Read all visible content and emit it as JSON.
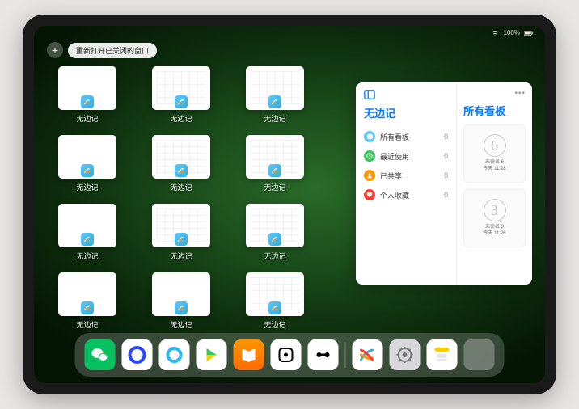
{
  "status": {
    "battery": "100%"
  },
  "topControls": {
    "add": "+",
    "reopenLabel": "重新打开已关闭的窗口"
  },
  "appWindows": [
    {
      "label": "无边记",
      "type": "blank"
    },
    {
      "label": "无边记",
      "type": "grid"
    },
    {
      "label": "无边记",
      "type": "grid"
    },
    {
      "label": "无边记",
      "type": "blank"
    },
    {
      "label": "无边记",
      "type": "grid"
    },
    {
      "label": "无边记",
      "type": "grid"
    },
    {
      "label": "无边记",
      "type": "blank"
    },
    {
      "label": "无边记",
      "type": "grid"
    },
    {
      "label": "无边记",
      "type": "grid"
    },
    {
      "label": "无边记",
      "type": "blank"
    },
    {
      "label": "无边记",
      "type": "blank"
    },
    {
      "label": "无边记",
      "type": "grid"
    }
  ],
  "sidePanel": {
    "leftTitle": "无边记",
    "rightTitle": "所有看板",
    "menu": [
      {
        "icon": "chat",
        "color": "#5ac8fa",
        "label": "所有看板",
        "count": "0"
      },
      {
        "icon": "clock",
        "color": "#34c759",
        "label": "最近使用",
        "count": "0"
      },
      {
        "icon": "person",
        "color": "#ff9500",
        "label": "已共享",
        "count": "0"
      },
      {
        "icon": "heart",
        "color": "#ff3b30",
        "label": "个人收藏",
        "count": "0"
      }
    ],
    "boards": [
      {
        "sketch": "6",
        "name": "未命名 6",
        "time": "今天 11:28"
      },
      {
        "sketch": "3",
        "name": "未命名 3",
        "time": "今天 11:26"
      }
    ]
  },
  "dock": [
    {
      "name": "wechat",
      "bg": "#07c160"
    },
    {
      "name": "quark",
      "bg": "#fff"
    },
    {
      "name": "qq-browser",
      "bg": "#fff"
    },
    {
      "name": "play",
      "bg": "#fff"
    },
    {
      "name": "books",
      "bg": "linear-gradient(#ff9500,#ff6a00)"
    },
    {
      "name": "dice",
      "bg": "#fff"
    },
    {
      "name": "connect",
      "bg": "#fff"
    },
    {
      "name": "freeform",
      "bg": "#fff"
    },
    {
      "name": "settings",
      "bg": "#d8d8dc"
    },
    {
      "name": "notes",
      "bg": "#fff"
    },
    {
      "name": "app-library",
      "bg": ""
    }
  ]
}
